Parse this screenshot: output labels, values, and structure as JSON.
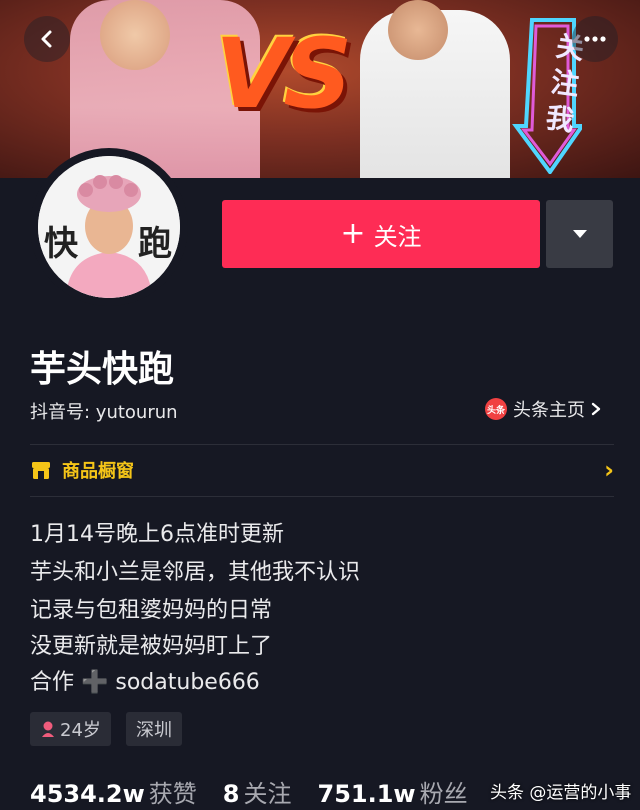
{
  "banner": {
    "vs_text": "VS",
    "sticker_text": "关注我"
  },
  "header": {
    "back_icon": "chevron-left-icon",
    "more_icon": "more-dots-icon"
  },
  "avatar": {
    "left_char": "快",
    "right_char": "跑"
  },
  "actions": {
    "follow_label": "关注",
    "follow_color": "#fe2c55",
    "dropdown_icon": "caret-down-icon"
  },
  "profile": {
    "name": "芋头快跑",
    "douyin_id": "抖音号: yutourun",
    "toutiao_badge": "头条",
    "toutiao_link": "头条主页"
  },
  "shop": {
    "label": "商品橱窗",
    "accent": "#f5c518"
  },
  "bio": [
    "1月14号晚上6点准时更新",
    "芋头和小兰是邻居，其他我不认识",
    "记录与包租婆妈妈的日常",
    "没更新就是被妈妈盯上了",
    "合作 ➕ sodatube666"
  ],
  "tags": {
    "age": "24岁",
    "city": "深圳"
  },
  "stats": {
    "likes_value": "4534.2w",
    "likes_label": "获赞",
    "following_value": "8",
    "following_label": "关注",
    "followers_value": "751.1w",
    "followers_label": "粉丝"
  },
  "watermark": "头条 @运营的小事"
}
